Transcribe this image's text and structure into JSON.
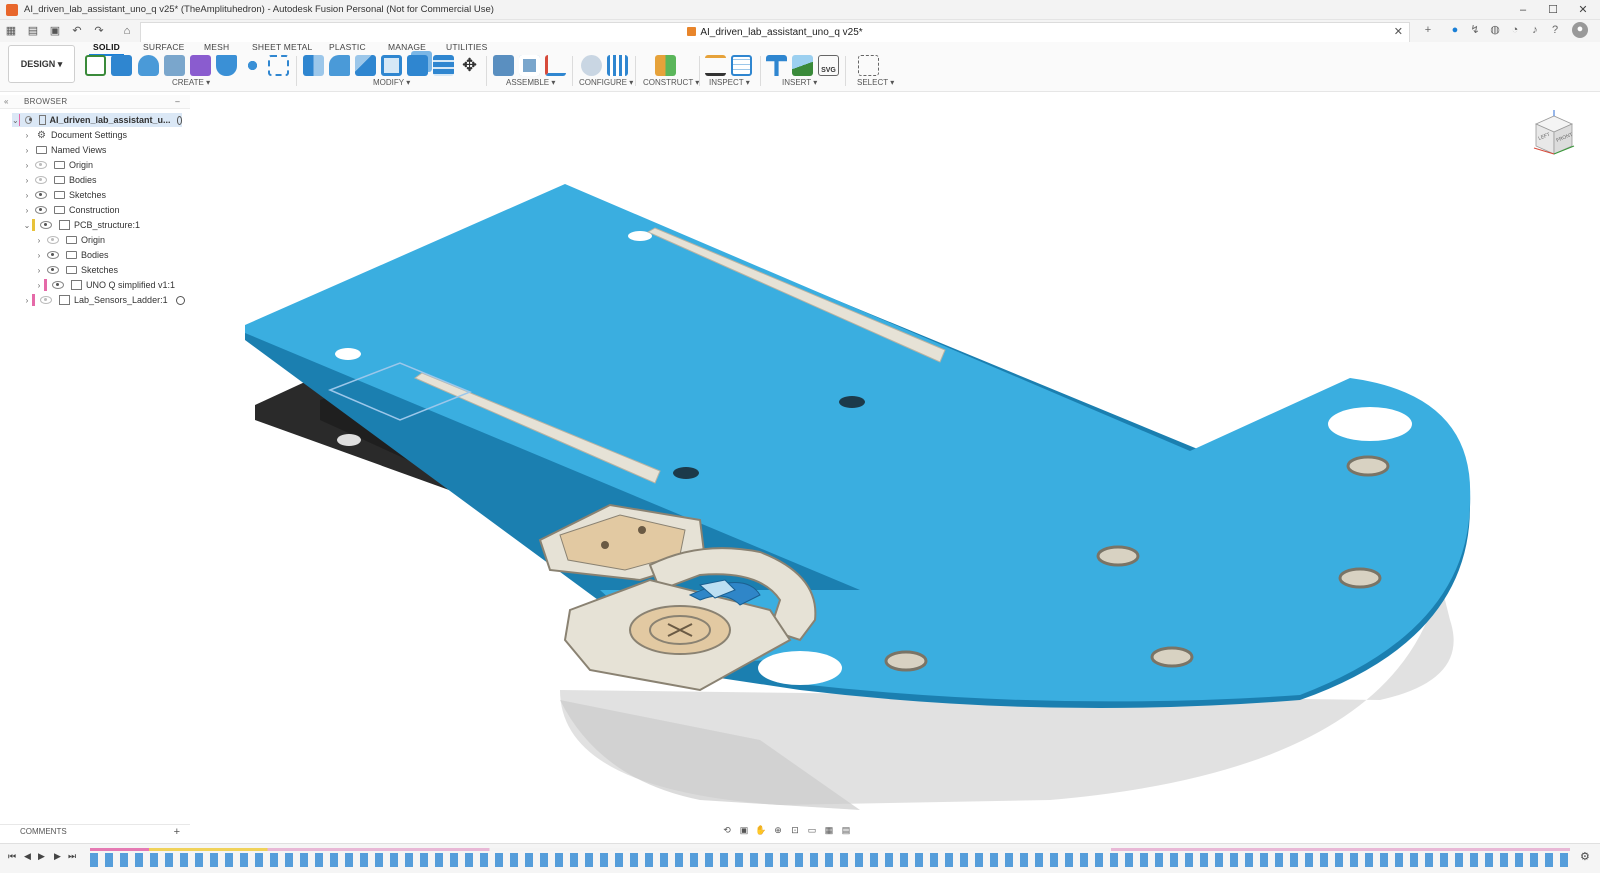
{
  "window": {
    "title": "AI_driven_lab_assistant_uno_q v25* (TheAmplituhedron) - Autodesk Fusion Personal (Not for Commercial Use)",
    "controls": [
      "–",
      "☐",
      "✕"
    ]
  },
  "doc_tab": {
    "label": "AI_driven_lab_assistant_uno_q v25*",
    "close": "✕"
  },
  "workspace": {
    "label": "DESIGN ▾",
    "tabs": [
      "SOLID",
      "SURFACE",
      "MESH",
      "SHEET METAL",
      "PLASTIC",
      "MANAGE",
      "UTILITIES"
    ],
    "active_tab": "SOLID"
  },
  "toolbar_groups": [
    {
      "label": "CREATE ▾"
    },
    {
      "label": "MODIFY ▾"
    },
    {
      "label": "ASSEMBLE ▾"
    },
    {
      "label": "CONFIGURE ▾"
    },
    {
      "label": "CONSTRUCT ▾"
    },
    {
      "label": "INSPECT ▾"
    },
    {
      "label": "INSERT ▾"
    },
    {
      "label": "SELECT ▾"
    }
  ],
  "browser": {
    "title": "BROWSER",
    "collapse": "–",
    "items": [
      {
        "label": "AI_driven_lab_assistant_u...",
        "icon": "component-icon"
      },
      {
        "label": "Document Settings",
        "icon": "gear-icon"
      },
      {
        "label": "Named Views",
        "icon": "folder-icon"
      },
      {
        "label": "Origin",
        "icon": "folder-icon"
      },
      {
        "label": "Bodies",
        "icon": "folder-icon"
      },
      {
        "label": "Sketches",
        "icon": "folder-icon"
      },
      {
        "label": "Construction",
        "icon": "folder-icon"
      },
      {
        "label": "PCB_structure:1",
        "icon": "component-icon"
      },
      {
        "label": "Origin",
        "icon": "folder-icon"
      },
      {
        "label": "Bodies",
        "icon": "folder-icon"
      },
      {
        "label": "Sketches",
        "icon": "folder-icon"
      },
      {
        "label": "UNO Q simplified v1:1",
        "icon": "component-icon"
      },
      {
        "label": "Lab_Sensors_Ladder:1",
        "icon": "component-icon"
      }
    ]
  },
  "comments": {
    "label": "COMMENTS",
    "add": "+"
  },
  "viewcube": {
    "left": "LEFT",
    "front": "FRONT"
  },
  "colors": {
    "plate": "#3aaee0",
    "plate_edge": "#1b7fb0",
    "rail": "#e6e2d6",
    "wood": "#e2c9a2",
    "dark_plate": "#2a2a2a",
    "accent": "#1a7fd6"
  }
}
